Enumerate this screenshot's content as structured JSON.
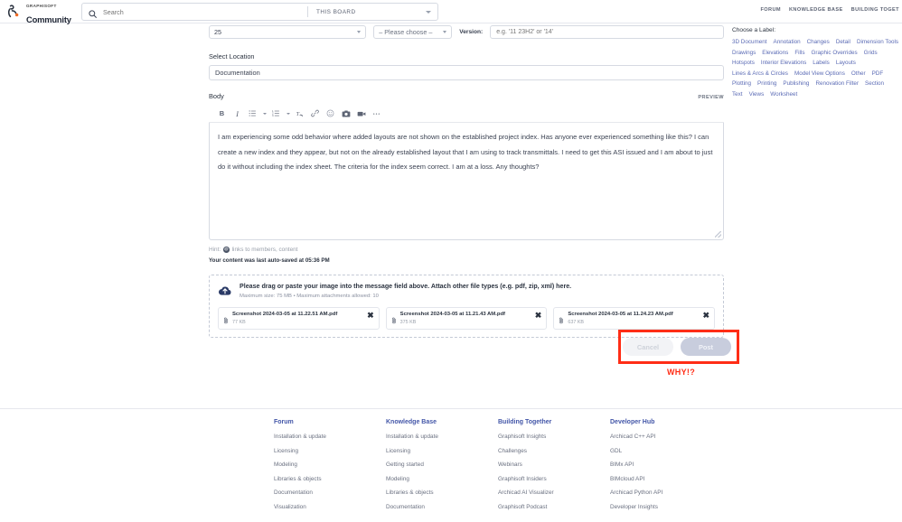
{
  "topbar": {
    "logo_icon": "graphisoft-person-icon",
    "logo_brand": "GRAPHISOFT",
    "logo_product": "Community",
    "search": {
      "icon": "search-icon",
      "value": "",
      "placeholder": "Search"
    },
    "board_scope": "THIS BOARD",
    "scope_caret_icon": "chevron-down-icon",
    "nav": [
      "FORUM",
      "KNOWLEDGE BASE",
      "BUILDING TOGET"
    ]
  },
  "form": {
    "quantity_select": "25",
    "choose_select": "– Please choose –",
    "version_label": "Version:",
    "version_placeholder": "e.g. '11 23H2' or '14'",
    "version_value": "",
    "location_label": "Select Location",
    "location_select": "Documentation",
    "body_label": "Body",
    "preview_label": "PREVIEW",
    "toolbar_icons": [
      "bold-icon",
      "italic-icon",
      "bullet-list-icon",
      "bullet-list-caret-icon",
      "numbered-list-icon",
      "numbered-list-caret-icon",
      "clear-formatting-icon",
      "link-icon",
      "emoji-icon",
      "image-icon",
      "video-icon",
      "more-options-icon"
    ],
    "body_text": "I am experiencing some odd behavior where added layouts are not shown on the established project index.  Has anyone ever experienced something like this?  I can create a new index and they appear, but not on the already established layout that I am using to track transmittals.  I need to get this ASI issued and I am about to just do it without including the index sheet.  The criteria for the index seem correct.  I am at a loss.  Any thoughts?",
    "hint_prefix": "Hint:",
    "hint_badge": "@",
    "hint_text": "links to members, content",
    "autosave_text": "Your content was last auto-saved at 05:36 PM"
  },
  "dropzone": {
    "icon": "cloud-upload-icon",
    "title": "Please drag or paste your image into the message field above. Attach other file types (e.g. pdf, zip, xml) here.",
    "subtitle": "Maximum size: 75 MB • Maximum attachments allowed: 10",
    "files": [
      {
        "icon": "paperclip-icon",
        "name": "Screenshot 2024-03-05 at 11.22.51 AM.pdf",
        "size": "77 KB",
        "remove_icon": "close-icon"
      },
      {
        "icon": "paperclip-icon",
        "name": "Screenshot 2024-03-05 at 11.21.43 AM.pdf",
        "size": "375 KB",
        "remove_icon": "close-icon"
      },
      {
        "icon": "paperclip-icon",
        "name": "Screenshot 2024-03-05 at 11.24.23 AM.pdf",
        "size": "637 KB",
        "remove_icon": "close-icon"
      }
    ]
  },
  "actions": {
    "cancel_label": "Cancel",
    "post_label": "Post",
    "annotation_text": "WHY!?",
    "annotation_color": "#ff2d16",
    "disabled": true
  },
  "labels": {
    "title": "Choose a Label:",
    "items": [
      "3D Document",
      "Annotation",
      "Changes",
      "Detail",
      "Dimension Tools",
      "Drawings",
      "Elevations",
      "Fills",
      "Graphic Overrides",
      "Grids",
      "Hotspots",
      "Interior Elevations",
      "Labels",
      "Layouts",
      "Lines & Arcs & Circles",
      "Model View Options",
      "Other",
      "PDF",
      "Plotting",
      "Printing",
      "Publishing",
      "Renovation Filter",
      "Section",
      "Text",
      "Views",
      "Worksheet"
    ],
    "link_color": "#5b6bb5"
  },
  "footer": {
    "columns": [
      {
        "heading": "Forum",
        "links": [
          "Installation & update",
          "Licensing",
          "Modeling",
          "Libraries & objects",
          "Documentation",
          "Visualization"
        ]
      },
      {
        "heading": "Knowledge Base",
        "links": [
          "Installation & update",
          "Licensing",
          "Getting started",
          "Modeling",
          "Libraries & objects",
          "Documentation"
        ]
      },
      {
        "heading": "Building Together",
        "links": [
          "Graphisoft Insights",
          "Challenges",
          "Webinars",
          "Graphisoft Insiders",
          "Archicad AI Visualizer",
          "Graphisoft Podcast"
        ]
      },
      {
        "heading": "Developer Hub",
        "links": [
          "Archicad C++ API",
          "GDL",
          "BIMx API",
          "BIMcloud API",
          "Archicad Python API",
          "Developer Insights"
        ]
      }
    ],
    "heading_color": "#4356a8"
  }
}
